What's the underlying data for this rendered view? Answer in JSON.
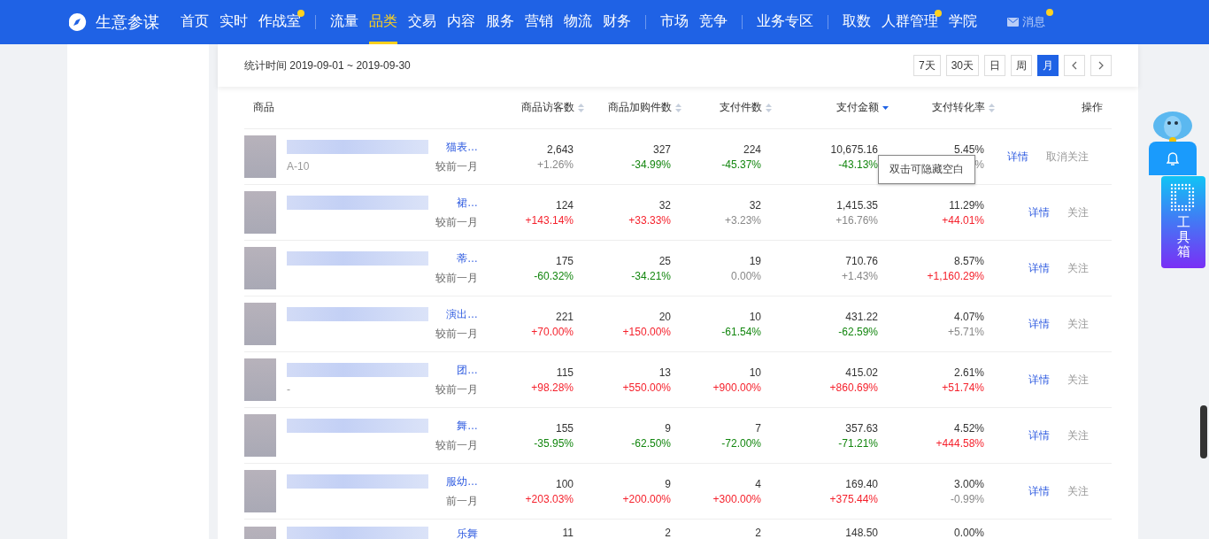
{
  "nav": {
    "brand": "生意参谋",
    "groups": [
      [
        {
          "label": "首页",
          "selected": false,
          "badge": false
        },
        {
          "label": "实时",
          "selected": false,
          "badge": false
        },
        {
          "label": "作战室",
          "selected": false,
          "badge": true
        }
      ],
      [
        {
          "label": "流量",
          "selected": false,
          "badge": false
        },
        {
          "label": "品类",
          "selected": true,
          "badge": false
        },
        {
          "label": "交易",
          "selected": false,
          "badge": false
        },
        {
          "label": "内容",
          "selected": false,
          "badge": false
        },
        {
          "label": "服务",
          "selected": false,
          "badge": false
        },
        {
          "label": "营销",
          "selected": false,
          "badge": false
        },
        {
          "label": "物流",
          "selected": false,
          "badge": false
        },
        {
          "label": "财务",
          "selected": false,
          "badge": false
        }
      ],
      [
        {
          "label": "市场",
          "selected": false,
          "badge": false
        },
        {
          "label": "竞争",
          "selected": false,
          "badge": false
        }
      ],
      [
        {
          "label": "业务专区",
          "selected": false,
          "badge": false
        }
      ],
      [
        {
          "label": "取数",
          "selected": false,
          "badge": false
        },
        {
          "label": "人群管理",
          "selected": false,
          "badge": true
        },
        {
          "label": "学院",
          "selected": false,
          "badge": false
        }
      ]
    ],
    "messages": {
      "label": "消息",
      "badge": true
    }
  },
  "filter": {
    "stat_time": "统计时间 2019-09-01 ~ 2019-09-30",
    "periods": [
      {
        "label": "7天",
        "selected": false
      },
      {
        "label": "30天",
        "selected": false
      },
      {
        "label": "日",
        "selected": false
      },
      {
        "label": "周",
        "selected": false
      },
      {
        "label": "月",
        "selected": true
      }
    ]
  },
  "table": {
    "columns": [
      {
        "label": "商品",
        "kind": "plain"
      },
      {
        "label": "商品访客数",
        "kind": "sortable",
        "sorted": false
      },
      {
        "label": "商品加购件数",
        "kind": "sortable",
        "sorted": false
      },
      {
        "label": "支付件数",
        "kind": "sortable",
        "sorted": false
      },
      {
        "label": "支付金额",
        "kind": "sortable",
        "sorted": true
      },
      {
        "label": "支付转化率",
        "kind": "sortable",
        "sorted": false
      },
      {
        "label": "操作",
        "kind": "plain"
      }
    ],
    "rows": [
      {
        "name": "猫表…",
        "subtitle": "A-10",
        "compare": "较前一月",
        "metrics": [
          {
            "value": "2,643",
            "change": "+1.26%",
            "color": "#888888"
          },
          {
            "value": "327",
            "change": "-34.99%",
            "color": "#13860f"
          },
          {
            "value": "224",
            "change": "-45.37%",
            "color": "#13860f"
          },
          {
            "value": "10,675.16",
            "change": "-43.13%",
            "color": "#13860f"
          },
          {
            "value": "5.45%",
            "change": "%",
            "color": "#888888"
          }
        ],
        "actions": [
          {
            "label": "详情",
            "kind": "detail"
          },
          {
            "label": "取消关注",
            "kind": "follow"
          }
        ]
      },
      {
        "name": "裙…",
        "compare": "较前一月",
        "metrics": [
          {
            "value": "124",
            "change": "+143.14%",
            "color": "#f5222d"
          },
          {
            "value": "32",
            "change": "+33.33%",
            "color": "#f5222d"
          },
          {
            "value": "32",
            "change": "+3.23%",
            "color": "#888888"
          },
          {
            "value": "1,415.35",
            "change": "+16.76%",
            "color": "#888888"
          },
          {
            "value": "11.29%",
            "change": "+44.01%",
            "color": "#f5222d"
          }
        ],
        "actions": [
          {
            "label": "详情",
            "kind": "detail"
          },
          {
            "label": "关注",
            "kind": "follow"
          }
        ]
      },
      {
        "name": "蒂…",
        "compare": "较前一月",
        "metrics": [
          {
            "value": "175",
            "change": "-60.32%",
            "color": "#13860f"
          },
          {
            "value": "25",
            "change": "-34.21%",
            "color": "#13860f"
          },
          {
            "value": "19",
            "change": "0.00%",
            "color": "#888888"
          },
          {
            "value": "710.76",
            "change": "+1.43%",
            "color": "#888888"
          },
          {
            "value": "8.57%",
            "change": "+1,160.29%",
            "color": "#f5222d"
          }
        ],
        "actions": [
          {
            "label": "详情",
            "kind": "detail"
          },
          {
            "label": "关注",
            "kind": "follow"
          }
        ]
      },
      {
        "name": "演出…",
        "compare": "较前一月",
        "metrics": [
          {
            "value": "221",
            "change": "+70.00%",
            "color": "#f5222d"
          },
          {
            "value": "20",
            "change": "+150.00%",
            "color": "#f5222d"
          },
          {
            "value": "10",
            "change": "-61.54%",
            "color": "#13860f"
          },
          {
            "value": "431.22",
            "change": "-62.59%",
            "color": "#13860f"
          },
          {
            "value": "4.07%",
            "change": "+5.71%",
            "color": "#888888"
          }
        ],
        "actions": [
          {
            "label": "详情",
            "kind": "detail"
          },
          {
            "label": "关注",
            "kind": "follow"
          }
        ]
      },
      {
        "name": "团…",
        "subtitle": "-",
        "compare": "较前一月",
        "metrics": [
          {
            "value": "115",
            "change": "+98.28%",
            "color": "#f5222d"
          },
          {
            "value": "13",
            "change": "+550.00%",
            "color": "#f5222d"
          },
          {
            "value": "10",
            "change": "+900.00%",
            "color": "#f5222d"
          },
          {
            "value": "415.02",
            "change": "+860.69%",
            "color": "#f5222d"
          },
          {
            "value": "2.61%",
            "change": "+51.74%",
            "color": "#f5222d"
          }
        ],
        "actions": [
          {
            "label": "详情",
            "kind": "detail"
          },
          {
            "label": "关注",
            "kind": "follow"
          }
        ]
      },
      {
        "name": "舞…",
        "compare": "较前一月",
        "metrics": [
          {
            "value": "155",
            "change": "-35.95%",
            "color": "#13860f"
          },
          {
            "value": "9",
            "change": "-62.50%",
            "color": "#13860f"
          },
          {
            "value": "7",
            "change": "-72.00%",
            "color": "#13860f"
          },
          {
            "value": "357.63",
            "change": "-71.21%",
            "color": "#13860f"
          },
          {
            "value": "4.52%",
            "change": "+444.58%",
            "color": "#f5222d"
          }
        ],
        "actions": [
          {
            "label": "详情",
            "kind": "detail"
          },
          {
            "label": "关注",
            "kind": "follow"
          }
        ]
      },
      {
        "name": "服幼…",
        "compare": "前一月",
        "metrics": [
          {
            "value": "100",
            "change": "+203.03%",
            "color": "#f5222d"
          },
          {
            "value": "9",
            "change": "+200.00%",
            "color": "#f5222d"
          },
          {
            "value": "4",
            "change": "+300.00%",
            "color": "#f5222d"
          },
          {
            "value": "169.40",
            "change": "+375.44%",
            "color": "#f5222d"
          },
          {
            "value": "3.00%",
            "change": "-0.99%",
            "color": "#888888"
          }
        ],
        "actions": [
          {
            "label": "详情",
            "kind": "detail"
          },
          {
            "label": "关注",
            "kind": "follow"
          }
        ]
      },
      {
        "name": "乐舞",
        "metrics": [
          {
            "value": "11"
          },
          {
            "value": "2"
          },
          {
            "value": "2"
          },
          {
            "value": "148.50"
          },
          {
            "value": "0.00%"
          }
        ]
      }
    ]
  },
  "tooltip": "双击可隐藏空白",
  "toolbox": {
    "label": "工具箱"
  }
}
